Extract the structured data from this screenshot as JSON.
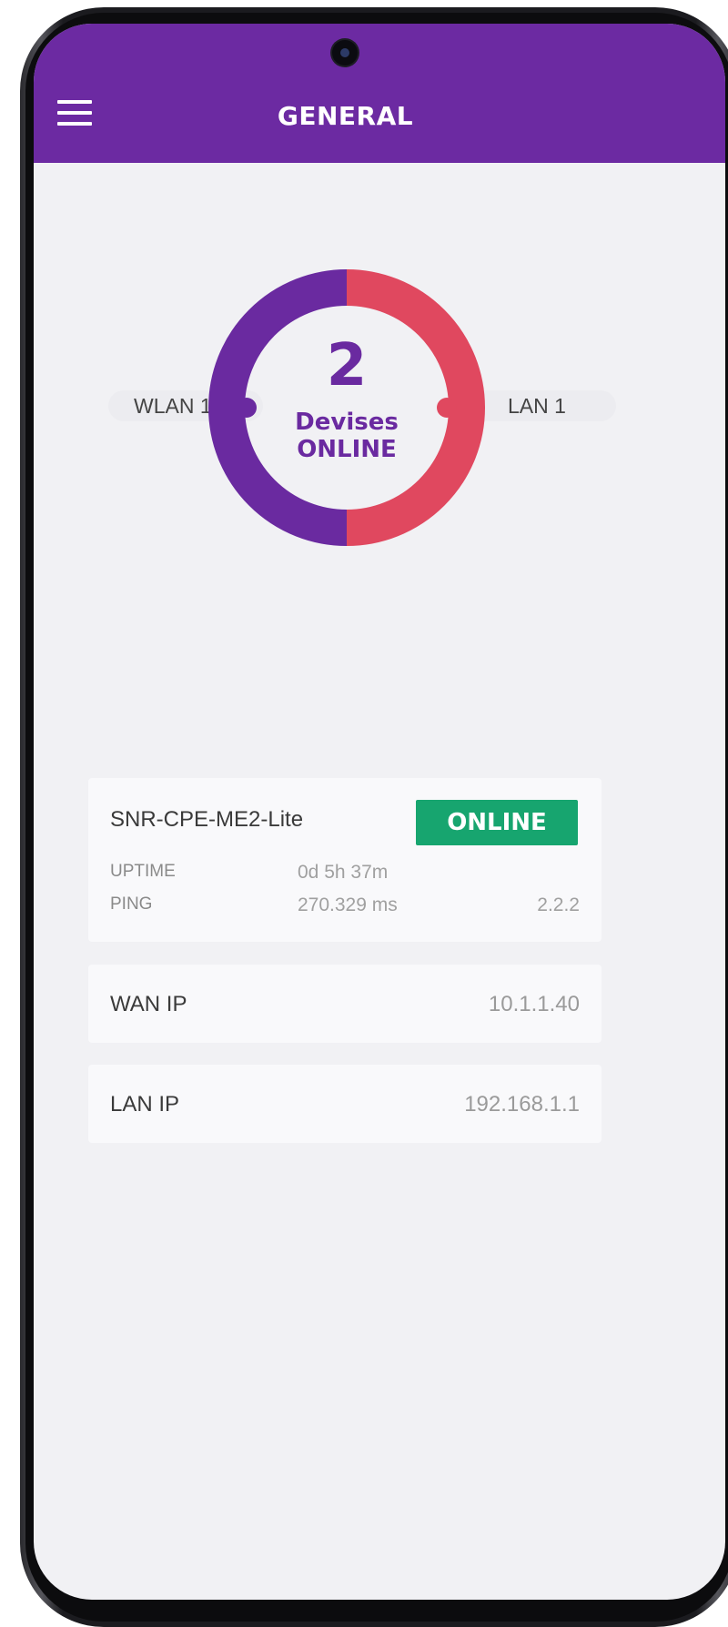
{
  "header": {
    "title": "GENERAL",
    "menu_icon": "hamburger-menu-icon",
    "color": "#6c2aa2"
  },
  "devices": {
    "count": "2",
    "label_line1": "Devises",
    "label_line2": "ONLINE",
    "wlan_label": "WLAN 1",
    "lan_label": "LAN 1",
    "wlan_color": "#6a2aa0",
    "lan_color": "#e0485f",
    "wlan_fraction": 0.5,
    "lan_fraction": 0.5
  },
  "device_card": {
    "name": "SNR-CPE-ME2-Lite",
    "status": "ONLINE",
    "status_color": "#17a56f",
    "uptime_label": "UPTIME",
    "uptime_value": "0d 5h 37m",
    "ping_label": "PING",
    "ping_value": "270.329 ms",
    "ping_extra": "2.2.2"
  },
  "wan_card": {
    "label": "WAN IP",
    "value": "10.1.1.40"
  },
  "lan_card": {
    "label": "LAN IP",
    "value": "192.168.1.1"
  }
}
